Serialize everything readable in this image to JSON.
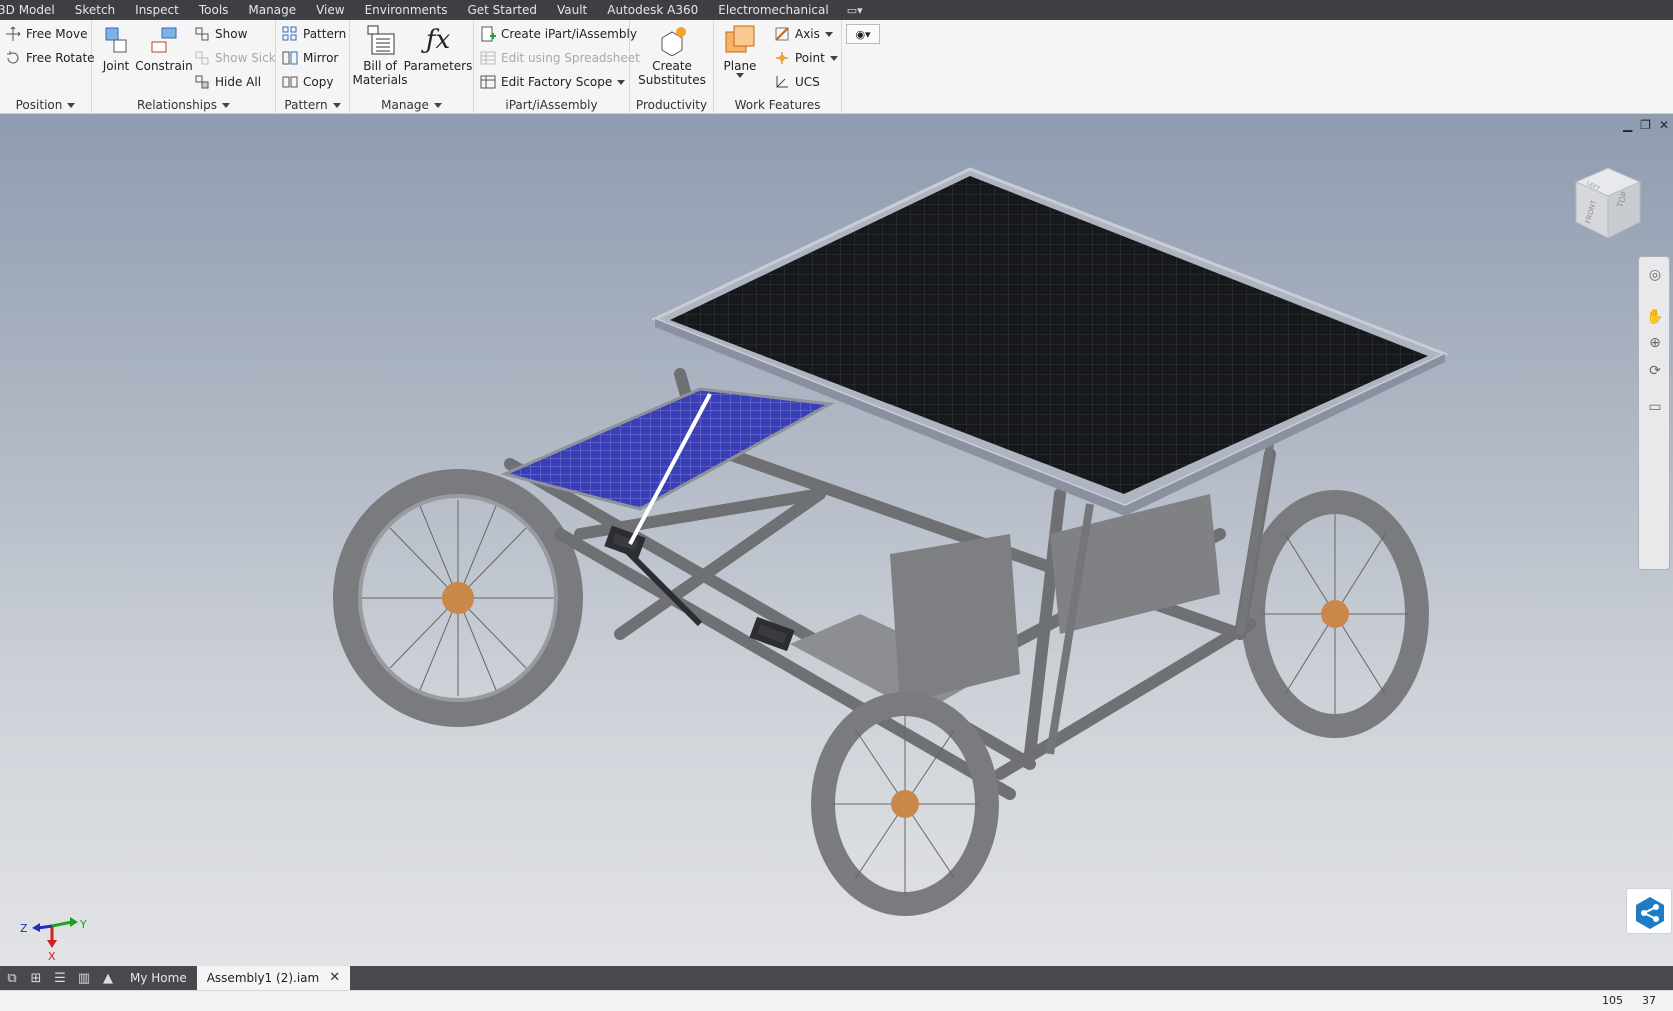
{
  "menu_tabs": [
    "3D Model",
    "Sketch",
    "Inspect",
    "Tools",
    "Manage",
    "View",
    "Environments",
    "Get Started",
    "Vault",
    "Autodesk A360",
    "Electromechanical"
  ],
  "ribbon": {
    "position": {
      "title": "Position",
      "free_move": "Free Move",
      "free_rotate": "Free Rotate"
    },
    "relationships": {
      "title": "Relationships",
      "joint": "Joint",
      "constrain": "Constrain",
      "show": "Show",
      "show_sick": "Show Sick",
      "hide_all": "Hide All"
    },
    "pattern": {
      "title": "Pattern",
      "pattern": "Pattern",
      "mirror": "Mirror",
      "copy": "Copy"
    },
    "manage": {
      "title": "Manage",
      "bom_line1": "Bill of",
      "bom_line2": "Materials",
      "parameters": "Parameters"
    },
    "ipart": {
      "title": "iPart/iAssembly",
      "create": "Create iPart/iAssembly",
      "edit_spreadsheet": "Edit using Spreadsheet",
      "edit_factory": "Edit Factory Scope"
    },
    "productivity": {
      "title": "Productivity",
      "line1": "Create",
      "line2": "Substitutes"
    },
    "work_features": {
      "title": "Work Features",
      "plane": "Plane",
      "axis": "Axis",
      "point": "Point",
      "ucs": "UCS"
    }
  },
  "viewcube": {
    "top_label": "TOP",
    "front_label": "FRONT",
    "left_label": "LEFT"
  },
  "triad": {
    "x": "X",
    "y": "Y",
    "z": "Z"
  },
  "doc_tabs": {
    "home": "My Home",
    "active": "Assembly1 (2).iam",
    "close": "✕"
  },
  "status": {
    "value1": "105",
    "value2": "37"
  },
  "colors": {
    "accent": "#1f7cc4",
    "solar_black": "#151719",
    "solar_blue": "#3a3fb8",
    "frame": "#6f7073",
    "hub": "#c9874a"
  }
}
